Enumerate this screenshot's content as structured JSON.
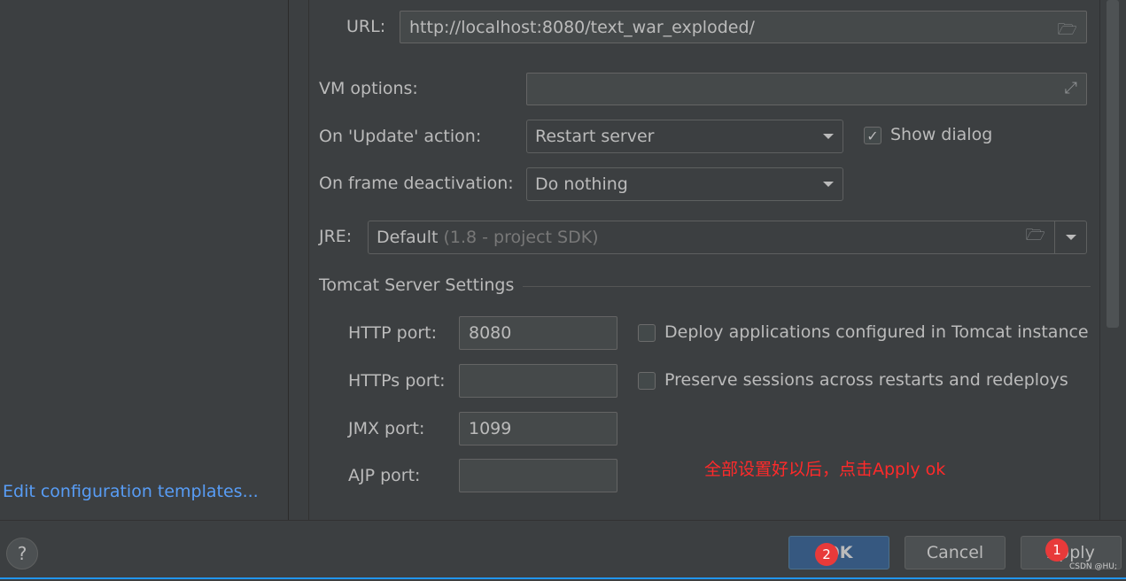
{
  "sidebar": {
    "edit_templates_link": "Edit configuration templates..."
  },
  "form": {
    "url_label": "URL:",
    "url_value": "http://localhost:8080/text_war_exploded/",
    "vm_label": "VM options:",
    "vm_value": "",
    "update_label": "On 'Update' action:",
    "update_value": "Restart server",
    "show_dialog_label": "Show dialog",
    "show_dialog_checked": true,
    "frame_label": "On frame deactivation:",
    "frame_value": "Do nothing",
    "jre_label": "JRE:",
    "jre_value": "Default",
    "jre_hint": "(1.8 - project SDK)"
  },
  "tomcat": {
    "section_title": "Tomcat Server Settings",
    "http_label": "HTTP port:",
    "http_value": "8080",
    "https_label": "HTTPs port:",
    "https_value": "",
    "jmx_label": "JMX port:",
    "jmx_value": "1099",
    "ajp_label": "AJP port:",
    "ajp_value": "",
    "deploy_label": "Deploy applications configured in Tomcat instance",
    "deploy_checked": false,
    "preserve_label": "Preserve sessions across restarts and redeploys",
    "preserve_checked": false
  },
  "annotation": {
    "text": "全部设置好以后，点击Apply  ok",
    "badge_ok": "2",
    "badge_apply": "1",
    "color": "#ff2a2a"
  },
  "footer": {
    "help": "?",
    "ok": "OK",
    "cancel": "Cancel",
    "apply": "Apply",
    "watermark": "CSDN @HU;"
  }
}
